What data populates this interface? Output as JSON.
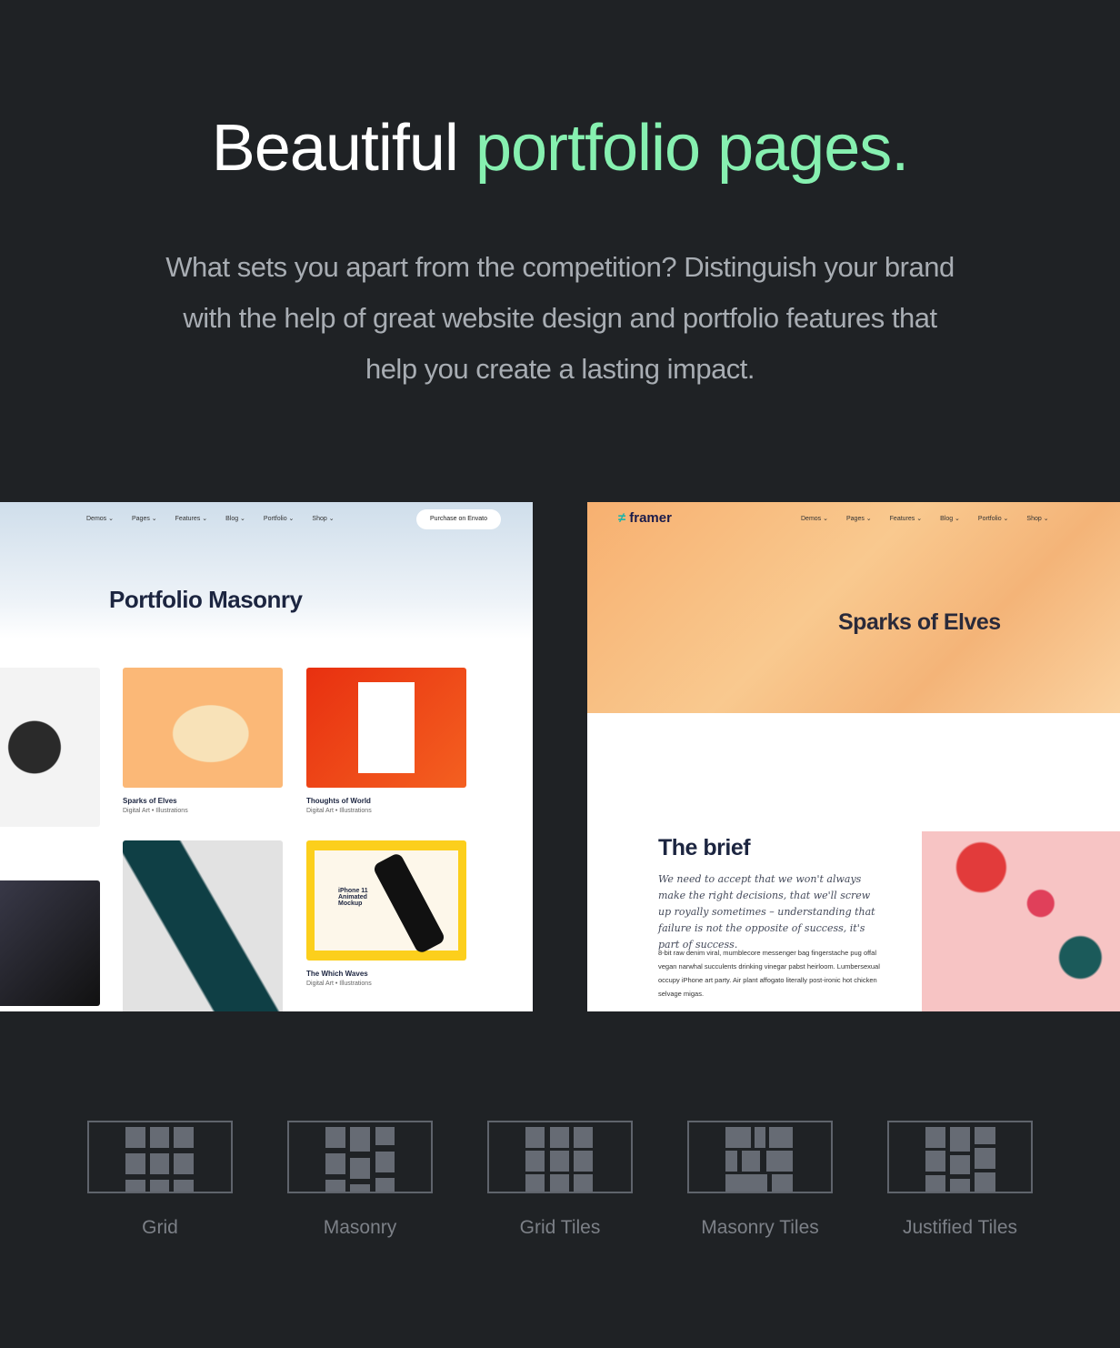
{
  "hero": {
    "title_plain": "Beautiful",
    "title_accent": "portfolio pages.",
    "subtitle": "What sets you apart from the competition? Distinguish your brand with the help of great website design and portfolio features that help you create a lasting impact."
  },
  "left_preview": {
    "nav": [
      "Demos ⌄",
      "Pages ⌄",
      "Features ⌄",
      "Blog ⌄",
      "Portfolio ⌄",
      "Shop ⌄"
    ],
    "cta": "Purchase on Envato",
    "title": "Portfolio Masonry",
    "items": [
      {
        "title": "Sparks of Elves",
        "meta": "Digital Art • Illustrations"
      },
      {
        "title": "Thoughts of World",
        "meta": "Digital Art • Illustrations"
      },
      {
        "title": "The Which Waves",
        "meta": "Digital Art • Illustrations"
      }
    ],
    "mockup_text": "iPhone 11 Animated Mockup"
  },
  "right_preview": {
    "logo": "framer",
    "nav": [
      "Demos ⌄",
      "Pages ⌄",
      "Features ⌄",
      "Blog ⌄",
      "Portfolio ⌄",
      "Shop ⌄"
    ],
    "hero_title": "Sparks of Elves",
    "brief_title": "The brief",
    "quote": "We need to accept that we won't always make the right decisions, that we'll screw up royally sometimes – understanding that failure is not the opposite of success, it's part of success.",
    "body": "8-bit raw denim viral, mumblecore messenger bag fingerstache pug offal vegan narwhal succulents drinking vinegar pabst heirloom. Lumbersexual occupy iPhone art party. Air plant affogato literally post-ironic hot chicken selvage migas."
  },
  "layouts": [
    "Grid",
    "Masonry",
    "Grid Tiles",
    "Masonry Tiles",
    "Justified Tiles"
  ],
  "colors": {
    "background": "#1f2225",
    "accent": "#86f0b0",
    "icon": "#666b74"
  }
}
